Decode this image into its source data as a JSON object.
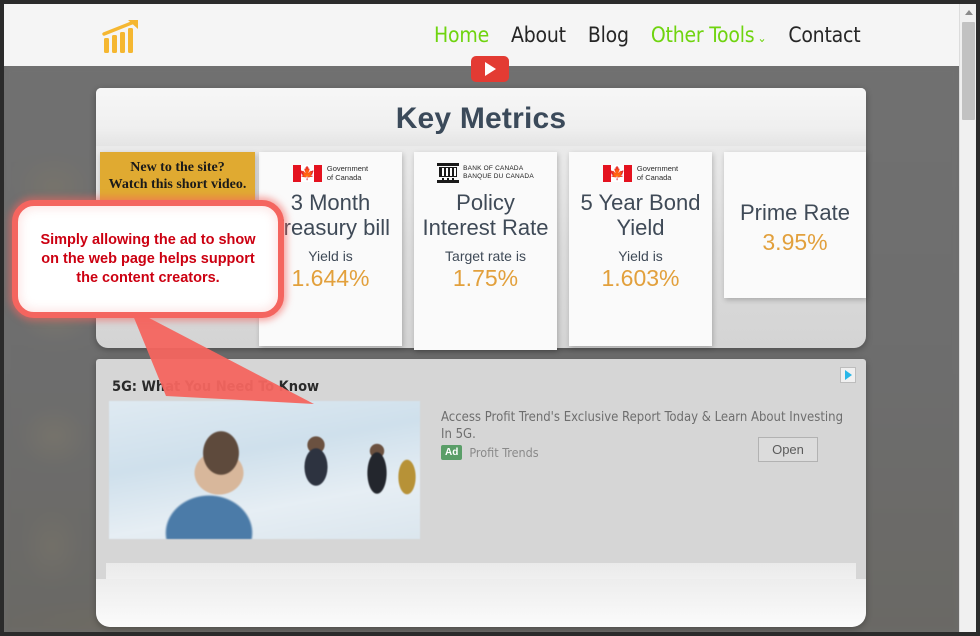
{
  "nav": {
    "logo_icon": "bar-chart-growth-icon",
    "links": [
      {
        "label": "Home",
        "active": true
      },
      {
        "label": "About",
        "active": false
      },
      {
        "label": "Blog",
        "active": false
      },
      {
        "label": "Other Tools",
        "active": true,
        "caret": "⌄"
      },
      {
        "label": "Contact",
        "active": false
      }
    ]
  },
  "metrics": {
    "title": "Key Metrics",
    "cards": [
      {
        "logo": "government-of-canada-logo",
        "logo_line1": "Government",
        "logo_line2": "of Canada",
        "name": "3 Month Treasury bill",
        "sub": "Yield is",
        "value": "1.644%"
      },
      {
        "logo": "bank-of-canada-logo",
        "logo_line1": "BANK OF CANADA",
        "logo_line2": "BANQUE DU CANADA",
        "name": "Policy Interest Rate",
        "sub": "Target rate is",
        "value": "1.75%"
      },
      {
        "logo": "government-of-canada-logo",
        "logo_line1": "Government",
        "logo_line2": "of Canada",
        "name": "5 Year Bond Yield",
        "sub": "Yield is",
        "value": "1.603%"
      },
      {
        "logo": "none",
        "logo_line1": "",
        "logo_line2": "",
        "name": "Prime Rate",
        "sub": "",
        "value": "3.95%"
      }
    ]
  },
  "video_promo": {
    "line1": "New to the site?",
    "line2": "Watch this short video.",
    "play_icon": "youtube-play-icon"
  },
  "callout": {
    "text": "Simply allowing the ad to show on the web page helps support the content creators."
  },
  "ad": {
    "adchoices_icon": "adchoices-icon",
    "headline": "5G: What You Need To Know",
    "body": "Access Profit Trend's Exclusive Report Today & Learn About Investing In 5G.",
    "badge": "Ad",
    "advertiser": "Profit Trends",
    "open_label": "Open",
    "image_alt": "businessman-with-tablet-photo"
  },
  "scrollbar": {
    "up_icon": "scroll-up-arrow-icon"
  },
  "colors": {
    "nav_active": "#6fd40f",
    "logo": "#f5b731",
    "metric_value": "#e2a03c",
    "metric_label": "#3f4a57",
    "callout_border": "#f4655f",
    "callout_text": "#cc0011",
    "ad_badge": "#5a9e68",
    "video_card": "#e0aa31"
  }
}
